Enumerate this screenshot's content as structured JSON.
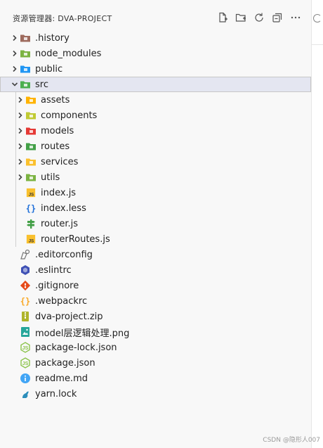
{
  "header": {
    "title": "资源管理器: DVA-PROJECT"
  },
  "actions": [
    {
      "name": "new-file-icon"
    },
    {
      "name": "new-folder-icon"
    },
    {
      "name": "refresh-icon"
    },
    {
      "name": "collapse-all-icon"
    },
    {
      "name": "more-icon"
    }
  ],
  "tree": [
    {
      "label": ".history",
      "type": "folder",
      "icon": "history-folder-icon",
      "color": "#9e6b5e"
    },
    {
      "label": "node_modules",
      "type": "folder",
      "icon": "node-modules-folder-icon",
      "color": "#7cb342"
    },
    {
      "label": "public",
      "type": "folder",
      "icon": "public-folder-icon",
      "color": "#2196f3"
    },
    {
      "label": "src",
      "type": "folder",
      "icon": "src-folder-icon",
      "color": "#4caf50",
      "expanded": true,
      "selected": true
    },
    {
      "label": "assets",
      "type": "folder",
      "icon": "assets-folder-icon",
      "color": "#ffb300",
      "indent": 1
    },
    {
      "label": "components",
      "type": "folder",
      "icon": "components-folder-icon",
      "color": "#c0ca33",
      "indent": 1
    },
    {
      "label": "models",
      "type": "folder",
      "icon": "models-folder-icon",
      "color": "#e53935",
      "indent": 1
    },
    {
      "label": "routes",
      "type": "folder",
      "icon": "routes-folder-icon",
      "color": "#43a047",
      "indent": 1
    },
    {
      "label": "services",
      "type": "folder",
      "icon": "services-folder-icon",
      "color": "#fbc02d",
      "indent": 1
    },
    {
      "label": "utils",
      "type": "folder",
      "icon": "utils-folder-icon",
      "color": "#7cb342",
      "indent": 1
    },
    {
      "label": "index.js",
      "type": "file",
      "icon": "javascript-file-icon",
      "color": "#f9c02d",
      "indent": 1
    },
    {
      "label": "index.less",
      "type": "file",
      "icon": "less-file-icon",
      "color": "#1e6fd9",
      "indent": 1
    },
    {
      "label": "router.js",
      "type": "file",
      "icon": "router-file-icon",
      "color": "#43a047",
      "indent": 1
    },
    {
      "label": "routerRoutes.js",
      "type": "file",
      "icon": "javascript-file-icon",
      "color": "#f9c02d",
      "indent": 1
    },
    {
      "label": ".editorconfig",
      "type": "file",
      "icon": "editorconfig-file-icon",
      "color": "#777777"
    },
    {
      "label": ".eslintrc",
      "type": "file",
      "icon": "eslint-file-icon",
      "color": "#3f51b5"
    },
    {
      "label": ".gitignore",
      "type": "file",
      "icon": "git-file-icon",
      "color": "#e64a19"
    },
    {
      "label": ".webpackrc",
      "type": "file",
      "icon": "json-braces-file-icon",
      "color": "#f9a825"
    },
    {
      "label": "dva-project.zip",
      "type": "file",
      "icon": "zip-file-icon",
      "color": "#afb42b"
    },
    {
      "label": "model层逻辑处理.png",
      "type": "file",
      "icon": "image-file-icon",
      "color": "#26a69a"
    },
    {
      "label": "package-lock.json",
      "type": "file",
      "icon": "npm-json-file-icon",
      "color": "#8bc34a"
    },
    {
      "label": "package.json",
      "type": "file",
      "icon": "npm-json-file-icon",
      "color": "#8bc34a"
    },
    {
      "label": "readme.md",
      "type": "file",
      "icon": "info-file-icon",
      "color": "#42a5f5"
    },
    {
      "label": "yarn.lock",
      "type": "file",
      "icon": "yarn-file-icon",
      "color": "#2c8ebb"
    }
  ],
  "watermark": "CSDN @隐形人007"
}
